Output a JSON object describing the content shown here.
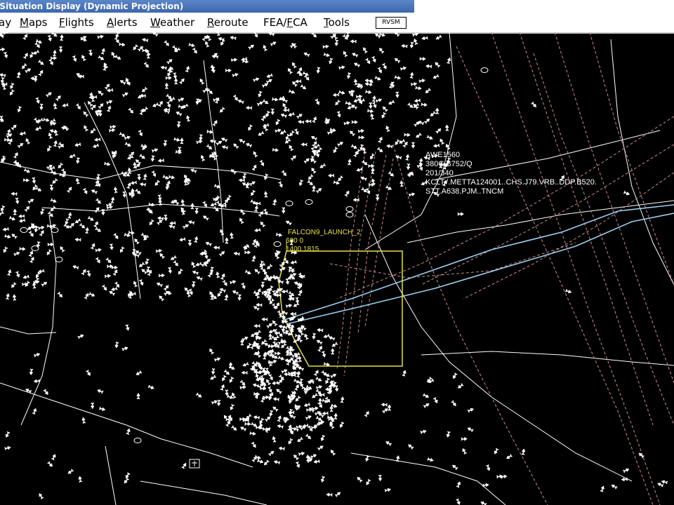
{
  "window": {
    "title": "ic Situation Display (Dynamic Projection)"
  },
  "menu": {
    "items": [
      {
        "pre": "",
        "ul": "",
        "label": "ay"
      },
      {
        "pre": "",
        "ul": "M",
        "label": "aps"
      },
      {
        "pre": "",
        "ul": "F",
        "label": "lights"
      },
      {
        "pre": "",
        "ul": "A",
        "label": "lerts"
      },
      {
        "pre": "",
        "ul": "W",
        "label": "eather"
      },
      {
        "pre": "",
        "ul": "R",
        "label": "eroute"
      },
      {
        "pre": "FEA/",
        "ul": "F",
        "label": "CA"
      },
      {
        "pre": "",
        "ul": "T",
        "label": "ools"
      }
    ],
    "rvsm_label": "RVSM"
  },
  "flight_datablock": {
    "callsign": "AWE1560",
    "line2": "380C B752/Q",
    "line3": "201/340",
    "route1": "KCLT./.METTA124001..CHS.J79.VRB..DDP.B520.",
    "route2": "STT.A638.PJM..TNCM"
  },
  "fea": {
    "name": "FALCON9_LAUNCH_2",
    "alt": "600  0",
    "time": "1400  1815"
  },
  "colors": {
    "fea_outline": "#e6e043",
    "route": "#9bd0f0",
    "airway": "#c88c8c",
    "boundary": "#ffffff"
  }
}
